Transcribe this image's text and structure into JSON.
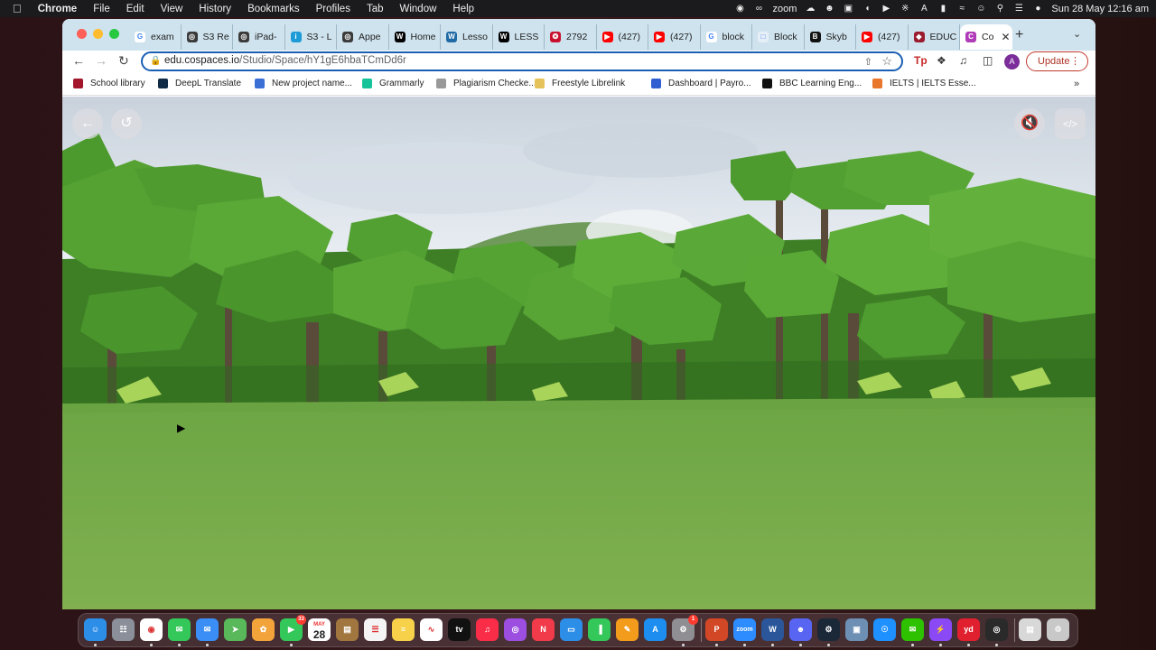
{
  "menubar": {
    "app": "Chrome",
    "items": [
      "File",
      "Edit",
      "View",
      "History",
      "Bookmarks",
      "Profiles",
      "Tab",
      "Window",
      "Help"
    ],
    "clock": "Sun 28 May  12:16 am",
    "zoom_label": "zoom"
  },
  "tabs": [
    {
      "label": "exam",
      "icon": "google-icon"
    },
    {
      "label": "S3 Re",
      "icon": "globe-icon"
    },
    {
      "label": "iPad-",
      "icon": "globe-icon"
    },
    {
      "label": "S3 - L",
      "icon": "info-icon"
    },
    {
      "label": "Appe",
      "icon": "globe-icon"
    },
    {
      "label": "Home",
      "icon": "wix-icon"
    },
    {
      "label": "Lesso",
      "icon": "wordpress-icon"
    },
    {
      "label": "LESS",
      "icon": "wix-icon"
    },
    {
      "label": "2792",
      "icon": "nsw-icon"
    },
    {
      "label": "(427)",
      "icon": "youtube-icon"
    },
    {
      "label": "(427)",
      "icon": "youtube-icon"
    },
    {
      "label": "block",
      "icon": "google-icon"
    },
    {
      "label": "Block",
      "icon": "doc-icon"
    },
    {
      "label": "Skyb",
      "icon": "bold-b-icon"
    },
    {
      "label": "(427)",
      "icon": "youtube-icon"
    },
    {
      "label": "EDUC",
      "icon": "shield-icon"
    },
    {
      "label": "Co",
      "icon": "cospaces-icon",
      "active": true
    }
  ],
  "toolbar": {
    "url_host": "edu.cospaces.io",
    "url_path": "/Studio/Space/hY1gE6hbaTCmDd6r",
    "update_label": "Update"
  },
  "bookmarks": [
    {
      "label": "School library",
      "color": "#a3162b"
    },
    {
      "label": "DeepL Translate",
      "color": "#0f2b46"
    },
    {
      "label": "New project name...",
      "color": "#3b6fd6"
    },
    {
      "label": "Grammarly",
      "color": "#15c39a"
    },
    {
      "label": "Plagiarism Checke...",
      "color": "#999999"
    },
    {
      "label": "Freestyle Librelink",
      "color": "#e6c35a"
    },
    {
      "label": "Dashboard | Payro...",
      "color": "#2f5fd0"
    },
    {
      "label": "BBC Learning Eng...",
      "color": "#111111"
    },
    {
      "label": "IELTS | IELTS Esse...",
      "color": "#e8762c"
    }
  ],
  "scene": {
    "buttons": [
      "back-button",
      "reset-button",
      "mute-button",
      "code-button"
    ]
  },
  "dock": {
    "calendar_month": "MAY",
    "calendar_day": "28",
    "facetime_badge": "33",
    "settings_badge": "1",
    "zoom_label": "zoom",
    "tv_label": "tv"
  },
  "colors": {
    "omnibox_border": "#1a5fb4",
    "update_border": "#c0392b",
    "ground": "#7fae4e",
    "sky": "#dfe6ee",
    "tabbar": "#cfe3ee"
  }
}
